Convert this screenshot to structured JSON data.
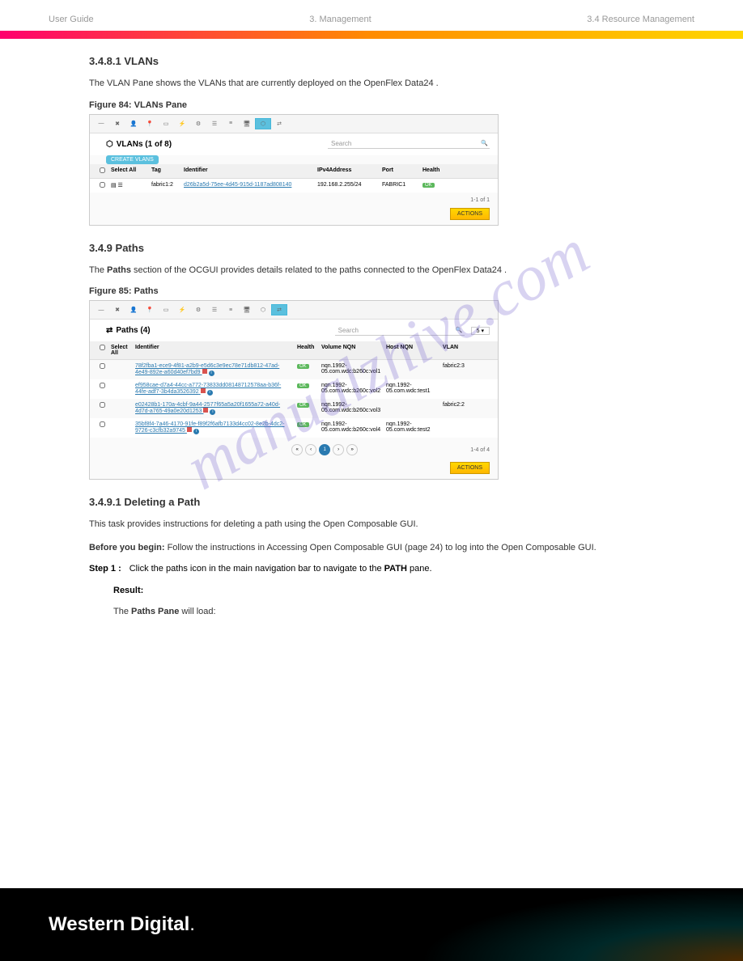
{
  "header": {
    "left": "User Guide",
    "center": "3. Management",
    "right": "3.4 Resource Management"
  },
  "section_vlans": {
    "title": "3.4.8.1  VLANs",
    "intro": "The VLAN Pane shows the VLANs that are currently deployed on the OpenFlex Data24 .",
    "figure": "Figure 84: VLANs Pane",
    "screenshot": {
      "pane_title": "VLANs (1 of 8)",
      "create_btn": "CREATE VLANS",
      "search_placeholder": "Search",
      "columns": [
        "Select All",
        "Tag",
        "Identifier",
        "IPv4Address",
        "Port",
        "Health"
      ],
      "row": {
        "tag": "fabric1:2",
        "identifier": "d26b2a5d-75ee-4d45-915d-1187ad808140",
        "ipv4": "192.168.2.255/24",
        "port": "FABRIC1",
        "health": "OK"
      },
      "pagination": "1-1 of 1",
      "actions": "ACTIONS"
    }
  },
  "section_paths": {
    "title": "3.4.9  Paths",
    "intro_pre": "The ",
    "intro_bold": "Paths",
    "intro_post": " section of the OCGUI provides details related to the paths connected to the OpenFlex Data24 .",
    "figure": "Figure 85: Paths",
    "screenshot": {
      "pane_title": "Paths (4)",
      "search_placeholder": "Search",
      "page_size": "5",
      "columns": [
        "Select All",
        "Identifier",
        "Health",
        "Volume NQN",
        "Host NQN",
        "VLAN"
      ],
      "rows": [
        {
          "id": "78f2fba1-ece9-4f81-a2b9-e5d6c3e9ec78e71db812-47ad-4e49-892e-a60d40ef7bd9",
          "health": "OK",
          "vol": "nqn.1992-05.com.wdc:b260c:vol1",
          "host": "",
          "vlan": "fabric2:3"
        },
        {
          "id": "ef958cae-d7a4-44cc-a772-73833dd08148712578aa-b36f-44fe-adf7-3b4da3526392",
          "health": "OK",
          "vol": "nqn.1992-05.com.wdc:b260c:vol2",
          "host": "nqn.1992-05.com.wdc:test1",
          "vlan": ""
        },
        {
          "id": "e02428b1-170a-4cbf-9a44-2577f65a5a20f1655a72-a40d-4d7d-a765-49a0e20d1253",
          "health": "OK",
          "vol": "nqn.1992-05.com.wdc:b260c:vol3",
          "host": "",
          "vlan": "fabric2:2"
        },
        {
          "id": "35bf8f4-7a46-4170-91fe-f89f2f6afb7133d4cc02-8e2b-4dc2-9726-c3cfb32a9745",
          "health": "OK",
          "vol": "nqn.1992-05.com.wdc:b260c:vol4",
          "host": "nqn.1992-05.com.wdc:test2",
          "vlan": ""
        }
      ],
      "pagination": "1-4 of 4",
      "actions": "ACTIONS"
    }
  },
  "section_delete": {
    "title": "3.4.9.1  Deleting a Path",
    "intro": "This task provides instructions for deleting a path using the Open Composable GUI.",
    "before_label": "Before you begin:",
    "before_text": "Follow the instructions in Accessing Open Composable GUI (page 24) to log into the Open Composable GUI.",
    "step_num": "Step 1 :",
    "step_pre": "Click the paths icon in the main navigation bar to navigate to the ",
    "step_bold": "PATH",
    "step_post": " pane.",
    "result_label": "Result:",
    "result_pre": "The ",
    "result_bold": "Paths Pane",
    "result_post": " will load:"
  },
  "footer": {
    "logo_bold": "Western Digital",
    "logo_dot": "."
  },
  "watermark": "manualzhive.com"
}
